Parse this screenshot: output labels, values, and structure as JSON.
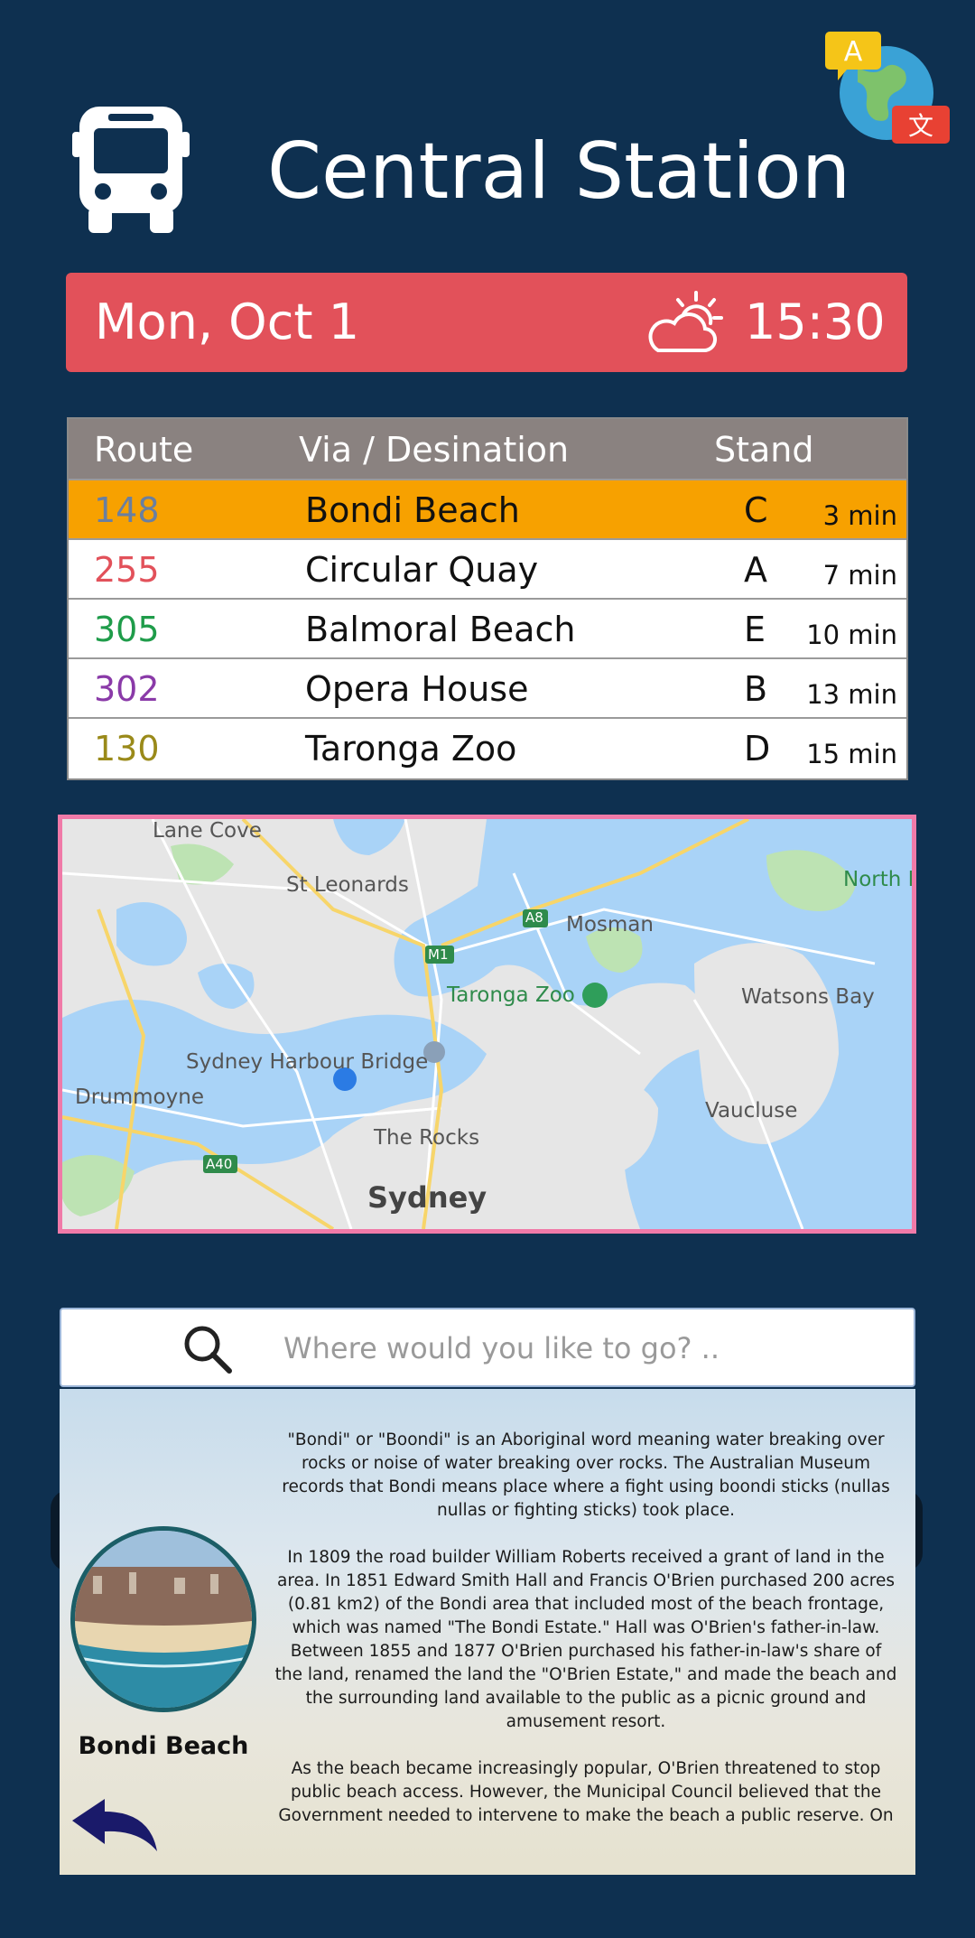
{
  "header": {
    "title": "Central Station",
    "bus_icon": "bus-icon",
    "language_icon": "language-globe-icon"
  },
  "datebar": {
    "date": "Mon, Oct 1",
    "weather_icon": "partly-sunny-icon",
    "time": "15:30"
  },
  "table": {
    "headers": [
      "Route",
      "Via / Desination",
      "Stand"
    ],
    "rows": [
      {
        "route": "148",
        "destination": "Bondi Beach",
        "stand": "C",
        "eta": "3 min",
        "route_color": "#6a7fa0",
        "highlight": true
      },
      {
        "route": "255",
        "destination": "Circular Quay",
        "stand": "A",
        "eta": "7 min",
        "route_color": "#e2515a",
        "highlight": false
      },
      {
        "route": "305",
        "destination": "Balmoral Beach",
        "stand": "E",
        "eta": "10 min",
        "route_color": "#1f9c4a",
        "highlight": false
      },
      {
        "route": "302",
        "destination": "Opera House",
        "stand": "B",
        "eta": "13 min",
        "route_color": "#8a3aa8",
        "highlight": false
      },
      {
        "route": "130",
        "destination": "Taronga Zoo",
        "stand": "D",
        "eta": "15 min",
        "route_color": "#9a8a1a",
        "highlight": false
      }
    ],
    "highlight_color": "#f7a100"
  },
  "map": {
    "labels": {
      "lane_cove": "Lane Cove",
      "st_leonards": "St Leonards",
      "north": "North H",
      "a8": "A8",
      "mosman": "Mosman",
      "m1": "M1",
      "taronga": "Taronga Zoo",
      "watsons": "Watsons Bay",
      "harbour_bridge": "Sydney Harbour Bridge",
      "drummoyne": "Drummoyne",
      "vaucluse": "Vaucluse",
      "rocks": "The Rocks",
      "a40": "A40",
      "sydney": "Sydney"
    }
  },
  "search": {
    "placeholder": "Where would you like to go? ..",
    "value": ""
  },
  "info": {
    "paragraphs": [
      "\"Bondi\" or \"Boondi\" is an Aboriginal word meaning water breaking over rocks or noise of water breaking over rocks. The Australian Museum records that Bondi means place where a fight using boondi sticks (nullas nullas or fighting sticks) took place.",
      "In 1809 the road builder William Roberts received a grant of land in the area. In 1851 Edward Smith Hall and Francis O'Brien purchased 200 acres (0.81 km2) of the Bondi area that included most of the beach frontage, which was named \"The Bondi Estate.\" Hall was O'Brien's father-in-law. Between 1855 and 1877 O'Brien purchased his father-in-law's share of the land, renamed the land the \"O'Brien Estate,\" and made the beach and the surrounding land available to the public as a picnic ground and amusement resort.",
      "As the beach became increasingly popular, O'Brien threatened to stop public beach access. However, the Municipal Council believed that the Government needed to intervene to make the beach a public reserve. On"
    ],
    "photo_caption": "Bondi Beach",
    "back_icon": "back-arrow-icon"
  }
}
